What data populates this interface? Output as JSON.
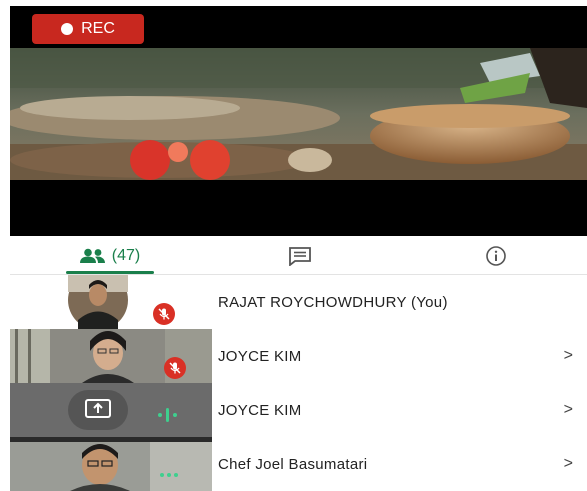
{
  "recording": {
    "label": "REC"
  },
  "tabs": {
    "participants_count": "(47)",
    "chat_icon": "chat-bubble-icon",
    "info_icon": "info-icon"
  },
  "participants": [
    {
      "name": "RAJAT ROYCHOWDHURY (You)",
      "muted": true,
      "has_chevron": false
    },
    {
      "name": "JOYCE KIM",
      "muted": true,
      "has_chevron": true,
      "chevron": ">"
    },
    {
      "name": "JOYCE KIM",
      "muted": false,
      "has_chevron": true,
      "chevron": ">"
    },
    {
      "name": "Chef Joel Basumatari",
      "muted": false,
      "has_chevron": true,
      "chevron": ">"
    }
  ],
  "colors": {
    "accent": "#1a7f4b",
    "rec": "#c8281f",
    "mute": "#d93025"
  }
}
